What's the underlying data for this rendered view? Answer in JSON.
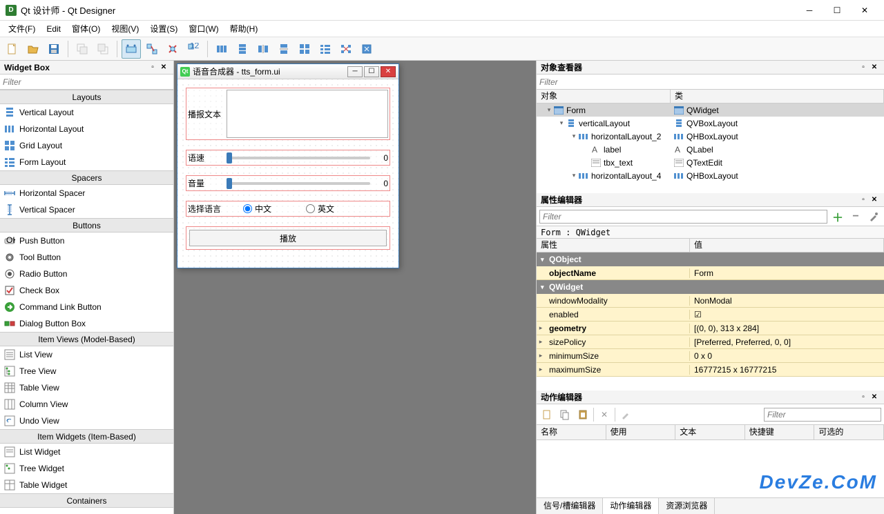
{
  "window": {
    "title": "Qt 设计师 - Qt Designer"
  },
  "menu": {
    "file": "文件(F)",
    "edit": "Edit",
    "window": "窗体(O)",
    "view": "视图(V)",
    "settings": "设置(S)",
    "windows": "窗口(W)",
    "help": "帮助(H)"
  },
  "widgetbox": {
    "title": "Widget Box",
    "filter_placeholder": "Filter",
    "categories": {
      "layouts": "Layouts",
      "spacers": "Spacers",
      "buttons": "Buttons",
      "item_views": "Item Views (Model-Based)",
      "item_widgets": "Item Widgets (Item-Based)",
      "containers": "Containers"
    },
    "items": {
      "vertical_layout": "Vertical Layout",
      "horizontal_layout": "Horizontal Layout",
      "grid_layout": "Grid Layout",
      "form_layout": "Form Layout",
      "horizontal_spacer": "Horizontal Spacer",
      "vertical_spacer": "Vertical Spacer",
      "push_button": "Push Button",
      "tool_button": "Tool Button",
      "radio_button": "Radio Button",
      "check_box": "Check Box",
      "command_link": "Command Link Button",
      "dialog_button_box": "Dialog Button Box",
      "list_view": "List View",
      "tree_view": "Tree View",
      "table_view": "Table View",
      "column_view": "Column View",
      "undo_view": "Undo View",
      "list_widget": "List Widget",
      "tree_widget": "Tree Widget",
      "table_widget": "Table Widget"
    }
  },
  "form": {
    "title": "语音合成器 - tts_form.ui",
    "labels": {
      "text": "播报文本",
      "speed": "语速",
      "volume": "音量",
      "language": "选择语言"
    },
    "values": {
      "speed": "0",
      "volume": "0"
    },
    "radios": {
      "chinese": "中文",
      "english": "英文"
    },
    "play_button": "播放"
  },
  "object_inspector": {
    "title": "对象查看器",
    "filter_placeholder": "Filter",
    "headers": {
      "object": "对象",
      "class": "类"
    },
    "tree": [
      {
        "name": "Form",
        "class": "QWidget",
        "depth": 0,
        "sel": true,
        "icon": "form"
      },
      {
        "name": "verticalLayout",
        "class": "QVBoxLayout",
        "depth": 1,
        "icon": "vlayout"
      },
      {
        "name": "horizontalLayout_2",
        "class": "QHBoxLayout",
        "depth": 2,
        "icon": "hlayout"
      },
      {
        "name": "label",
        "class": "QLabel",
        "depth": 3,
        "icon": "label"
      },
      {
        "name": "tbx_text",
        "class": "QTextEdit",
        "depth": 3,
        "icon": "text"
      },
      {
        "name": "horizontalLayout_4",
        "class": "QHBoxLayout",
        "depth": 2,
        "icon": "hlayout"
      }
    ]
  },
  "property_editor": {
    "title": "属性编辑器",
    "filter_placeholder": "Filter",
    "path": "Form : QWidget",
    "headers": {
      "property": "属性",
      "value": "值"
    },
    "groups": {
      "qobject": "QObject",
      "qwidget": "QWidget"
    },
    "props": [
      {
        "name": "objectName",
        "value": "Form",
        "bold": true
      },
      {
        "name": "windowModality",
        "value": "NonModal"
      },
      {
        "name": "enabled",
        "value": "☑"
      },
      {
        "name": "geometry",
        "value": "[(0, 0), 313 x 284]",
        "bold": true,
        "exp": true
      },
      {
        "name": "sizePolicy",
        "value": "[Preferred, Preferred, 0, 0]",
        "exp": true
      },
      {
        "name": "minimumSize",
        "value": "0 x 0",
        "exp": true
      },
      {
        "name": "maximumSize",
        "value": "16777215 x 16777215",
        "exp": true
      }
    ]
  },
  "action_editor": {
    "title": "动作编辑器",
    "filter_placeholder": "Filter",
    "headers": {
      "name": "名称",
      "use": "使用",
      "text": "文本",
      "shortcut": "快捷键",
      "checkable": "可选的"
    }
  },
  "bottom_tabs": {
    "signal": "信号/槽编辑器",
    "action": "动作编辑器",
    "resource": "资源浏览器"
  },
  "watermark": "DevZe.CoM"
}
